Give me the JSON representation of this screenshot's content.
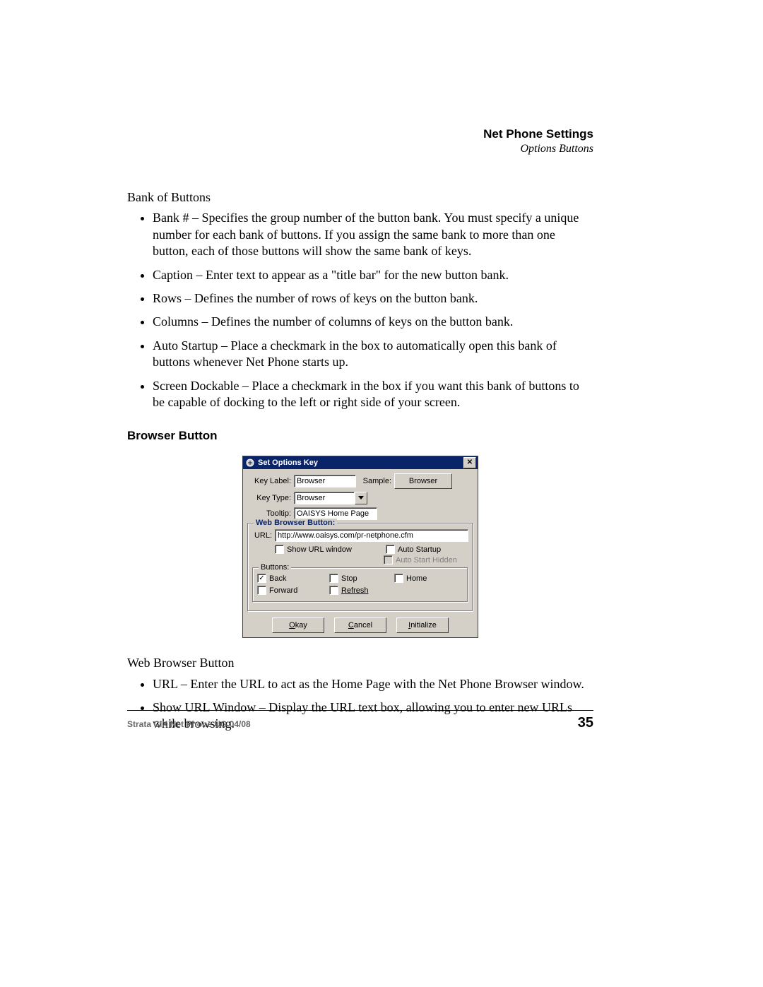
{
  "header": {
    "title": "Net Phone Settings",
    "subtitle": "Options Buttons"
  },
  "section1": {
    "heading": "Bank of Buttons",
    "bullets": [
      "Bank # – Specifies the group number of the button bank.  You must specify a unique number for each bank of buttons.  If you assign the same bank to more than one button, each of those buttons will show the same bank of keys.",
      "Caption – Enter text to appear as a \"title bar\" for the new button bank.",
      "Rows – Defines the number of rows of keys on the button bank.",
      "Columns – Defines the number of columns of keys on the button bank.",
      "Auto Startup – Place a checkmark in the box to automatically open this bank of buttons whenever Net Phone starts up.",
      "Screen Dockable – Place a checkmark in the box if you want this bank of buttons to be capable of docking to the left or right side of your screen."
    ]
  },
  "section2": {
    "heading": "Browser Button"
  },
  "dialog": {
    "title": "Set Options Key",
    "labels": {
      "keyLabel": "Key Label:",
      "keyType": "Key Type:",
      "tooltip": "Tooltip:",
      "sample": "Sample:",
      "url": "URL:",
      "buttonsGroup": "Buttons:"
    },
    "values": {
      "keyLabel": "Browser",
      "keyType": "Browser",
      "tooltip": "OAISYS Home Page",
      "sampleBtn": "Browser",
      "url": "http://www.oaisys.com/pr-netphone.cfm",
      "groupLegend": "Web Browser Button:"
    },
    "checkboxes": {
      "showUrl": "Show URL window",
      "autoStartup": "Auto Startup",
      "autoStartHidden": "Auto Start Hidden",
      "back": "Back",
      "stop": "Stop",
      "home": "Home",
      "forward": "Forward",
      "refresh": "Refresh"
    },
    "buttons": {
      "okay": "kay",
      "okayPrefix": "O",
      "cancel": "ancel",
      "cancelPrefix": "C",
      "initialize": "nitialize",
      "initializePrefix": "I"
    }
  },
  "section3": {
    "heading": "Web Browser Button",
    "bullets": [
      "URL – Enter the URL to act as the Home Page with the Net Phone Browser window.",
      "Show URL Window – Display the URL text box, allowing you to enter new URLs while browsing."
    ]
  },
  "footer": {
    "left": "Strata CIX Net Phone UG     04/08",
    "page": "35"
  }
}
